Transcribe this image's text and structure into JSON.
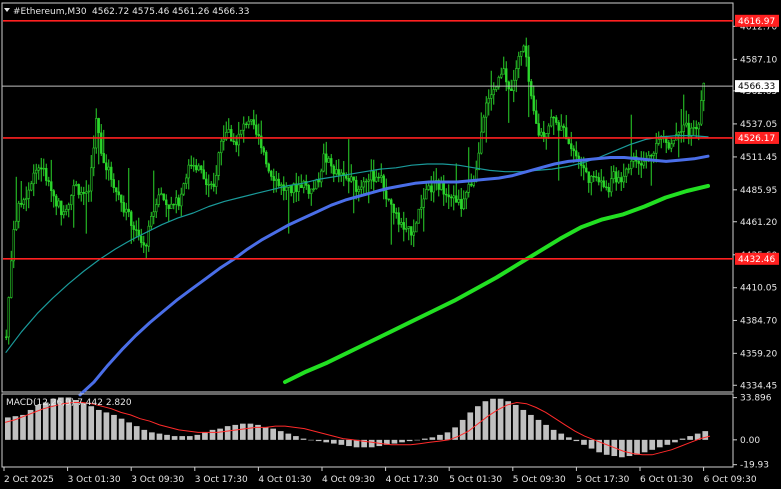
{
  "chart_data": {
    "type": "candlestick",
    "header": {
      "symbol": "#Ethereum,M30",
      "ohlc": "4562.72 4575.46 4561.26 4566.33"
    },
    "y_axis": {
      "ticks": [
        4612.7,
        4587.1,
        4562.65,
        4537.05,
        4511.45,
        4485.95,
        4461.2,
        4435.6,
        4410.05,
        4384.7,
        4359.2,
        4334.45
      ],
      "ylim": [
        4330.0,
        4630.0
      ]
    },
    "x_axis": {
      "ticks": [
        "2 Oct 2025",
        "3 Oct 01:30",
        "3 Oct 09:30",
        "3 Oct 17:30",
        "4 Oct 01:30",
        "4 Oct 09:30",
        "4 Oct 17:30",
        "5 Oct 01:30",
        "5 Oct 09:30",
        "5 Oct 17:30",
        "6 Oct 01:30",
        "6 Oct 09:30"
      ]
    },
    "levels": [
      {
        "value": 4616.97,
        "label": "4616.97",
        "color": "#ff2020"
      },
      {
        "value": 4526.17,
        "label": "4526.17",
        "color": "#ff2020"
      },
      {
        "value": 4432.46,
        "label": "4432.46",
        "color": "#ff2020"
      }
    ],
    "current_price": {
      "value": 4566.33,
      "label": "4566.33"
    },
    "price_path": [
      4372,
      4456,
      4475,
      4484,
      4500,
      4505,
      4492,
      4480,
      4470,
      4477,
      4490,
      4482,
      4486,
      4540,
      4510,
      4498,
      4485,
      4473,
      4462,
      4450,
      4440,
      4462,
      4485,
      4477,
      4472,
      4478,
      4498,
      4508,
      4502,
      4490,
      4485,
      4522,
      4533,
      4522,
      4530,
      4542,
      4530,
      4522,
      4502,
      4495,
      4487,
      4485,
      4488,
      4492,
      4485,
      4490,
      4512,
      4504,
      4498,
      4494,
      4493,
      4486,
      4497,
      4496,
      4498,
      4482,
      4470,
      4460,
      4452,
      4456,
      4474,
      4484,
      4490,
      4488,
      4485,
      4477,
      4473,
      4487,
      4498,
      4544,
      4556,
      4566,
      4578,
      4560,
      4584,
      4597,
      4555,
      4530,
      4530,
      4542,
      4535,
      4530,
      4518,
      4508,
      4498,
      4492,
      4497,
      4485,
      4496,
      4495,
      4505,
      4510,
      4504,
      4511,
      4521,
      4527,
      4521,
      4530,
      4537,
      4530,
      4532,
      4566
    ],
    "moving_averages": [
      {
        "name": "MA teal",
        "color": "#1a9a9a",
        "width": 1.2,
        "values": [
          4360,
          4376,
          4390,
          4402,
          4413,
          4423,
          4432,
          4440,
          4447,
          4453,
          4459,
          4464,
          4468,
          4473,
          4477,
          4480,
          4483,
          4486,
          4489,
          4491,
          4494,
          4496,
          4498,
          4500,
          4502,
          4503,
          4505,
          4506,
          4506,
          4505,
          4503,
          4501,
          4500,
          4500,
          4501,
          4502,
          4504,
          4507,
          4511,
          4516,
          4521,
          4525,
          4527,
          4528,
          4528,
          4527
        ]
      },
      {
        "name": "MA blue",
        "color": "#4a6ee8",
        "width": 3,
        "values": [
          4327,
          4337,
          4350,
          4362,
          4373,
          4383,
          4392,
          4401,
          4409,
          4417,
          4425,
          4432,
          4440,
          4447,
          4453,
          4459,
          4464,
          4469,
          4474,
          4478,
          4481,
          4484,
          4487,
          4489,
          4491,
          4492,
          4492,
          4492,
          4493,
          4494,
          4495,
          4497,
          4500,
          4503,
          4506,
          4508,
          4509,
          4510,
          4511,
          4511,
          4510,
          4509,
          4508,
          4509,
          4510,
          4512
        ]
      },
      {
        "name": "MA green",
        "color": "#22e022",
        "width": 4,
        "values": [
          4337,
          4345,
          4352,
          4360,
          4368,
          4376,
          4384,
          4392,
          4400,
          4409,
          4418,
          4428,
          4438,
          4448,
          4457,
          4463,
          4467,
          4473,
          4480,
          4485,
          4489
        ]
      }
    ],
    "macd": {
      "label": "MACD(12,26,9) 7.442 2.820",
      "ticks": [
        33.896,
        0.0,
        -19.93
      ],
      "ylim": [
        -21,
        36
      ],
      "histogram": [
        18,
        19,
        20,
        24,
        28,
        30,
        33,
        34,
        34,
        32,
        30,
        27,
        24,
        22,
        20,
        17,
        14,
        11,
        8,
        6,
        5,
        4,
        3,
        3,
        3,
        4,
        6,
        8,
        9,
        11,
        12,
        13,
        13,
        12,
        10,
        9,
        7,
        5,
        3,
        1,
        0,
        -1,
        -2,
        -3,
        -4,
        -5,
        -6,
        -6,
        -6,
        -5,
        -4,
        -3,
        -2,
        -1,
        0,
        1,
        2,
        4,
        6,
        10,
        16,
        22,
        27,
        31,
        33,
        33,
        31,
        28,
        24,
        20,
        16,
        12,
        8,
        5,
        2,
        -1,
        -4,
        -7,
        -10,
        -12,
        -13,
        -14,
        -13,
        -12,
        -10,
        -8,
        -6,
        -4,
        -2,
        1,
        3,
        5,
        7
      ],
      "signal": [
        14,
        16,
        19,
        22,
        25,
        27,
        29,
        30,
        30,
        29,
        27,
        25,
        22,
        20,
        17,
        15,
        12,
        10,
        8,
        7,
        6,
        6,
        6,
        7,
        8,
        9,
        10,
        10,
        11,
        11,
        10,
        9,
        7,
        5,
        3,
        1,
        0,
        -1,
        -2,
        -3,
        -4,
        -4,
        -4,
        -3,
        -2,
        -1,
        0,
        3,
        7,
        13,
        19,
        24,
        28,
        30,
        29,
        26,
        22,
        17,
        12,
        7,
        3,
        0,
        -3,
        -6,
        -9,
        -11,
        -12,
        -12,
        -10,
        -8,
        -5,
        -2,
        1,
        3
      ]
    }
  }
}
